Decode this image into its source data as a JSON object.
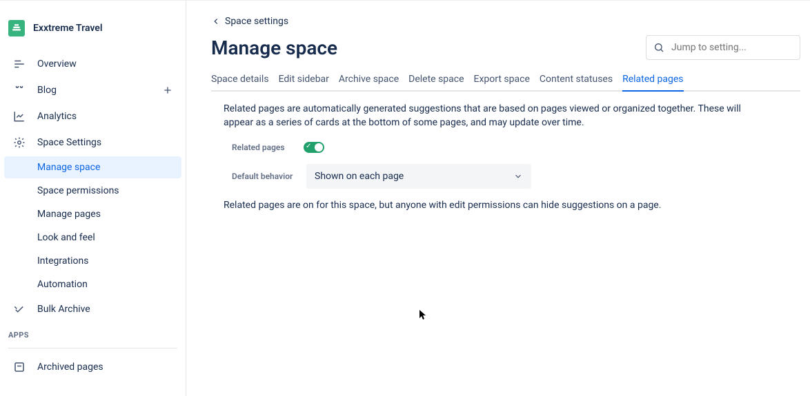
{
  "sidebar": {
    "space_name": "Exxtreme Travel",
    "items": [
      {
        "label": "Overview"
      },
      {
        "label": "Blog"
      },
      {
        "label": "Analytics"
      },
      {
        "label": "Space Settings"
      }
    ],
    "sub_items": [
      {
        "label": "Manage space",
        "active": true
      },
      {
        "label": "Space permissions"
      },
      {
        "label": "Manage pages"
      },
      {
        "label": "Look and feel"
      },
      {
        "label": "Integrations"
      },
      {
        "label": "Automation"
      }
    ],
    "bulk": {
      "label": "Bulk Archive"
    },
    "apps_label": "APPS",
    "archived": {
      "label": "Archived pages"
    }
  },
  "back_link": "Space settings",
  "page_title": "Manage space",
  "search": {
    "placeholder": "Jump to setting..."
  },
  "tabs": {
    "items": [
      "Space details",
      "Edit sidebar",
      "Archive space",
      "Delete space",
      "Export space",
      "Content statuses",
      "Related pages"
    ],
    "active": "Related pages"
  },
  "content": {
    "description": "Related pages are automatically generated suggestions that are based on pages viewed or organized together. These will appear as a series of cards at the bottom of some pages, and may update over time.",
    "toggle_label": "Related pages",
    "toggle_on": true,
    "default_label": "Default behavior",
    "default_value": "Shown on each page",
    "note": "Related pages are on for this space, but anyone with edit permissions can hide suggestions on a page."
  }
}
